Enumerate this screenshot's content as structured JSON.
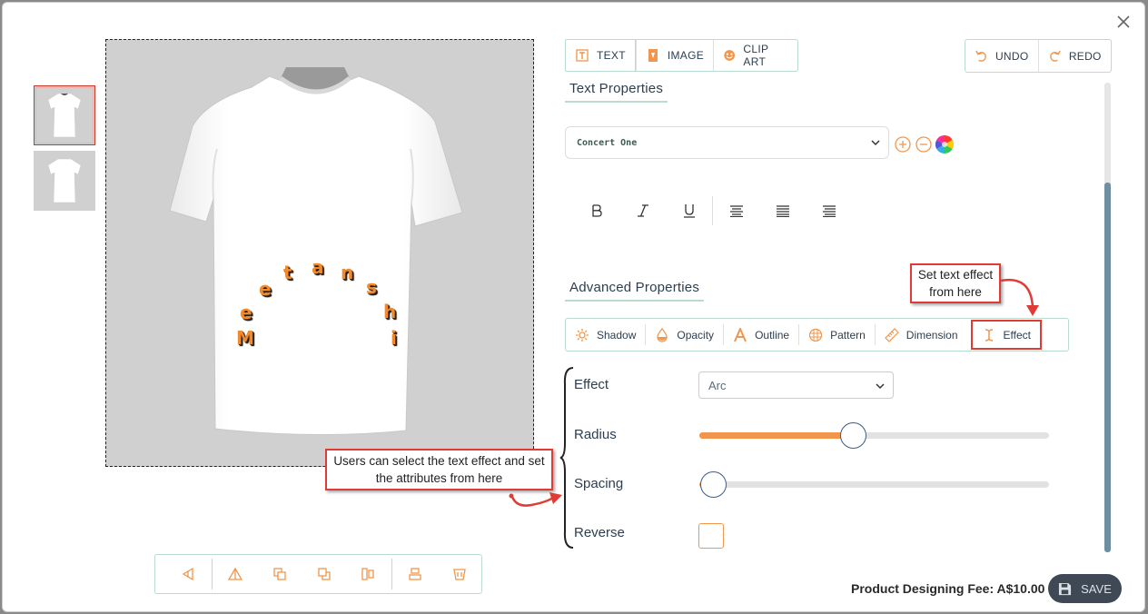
{
  "tabs": [
    {
      "label": "TEXT",
      "icon": "text-frame-icon",
      "active": true
    },
    {
      "label": "IMAGE",
      "icon": "image-icon",
      "active": false
    },
    {
      "label": "CLIP ART",
      "icon": "clip-art-icon",
      "active": false
    }
  ],
  "undo_label": "UNDO",
  "redo_label": "REDO",
  "text_properties_title": "Text Properties",
  "font": {
    "selected": "Concert One"
  },
  "advanced_properties_title": "Advanced Properties",
  "advanced_tabs": [
    {
      "label": "Shadow",
      "icon": "sun-icon"
    },
    {
      "label": "Opacity",
      "icon": "drop-icon"
    },
    {
      "label": "Outline",
      "icon": "letter-a-icon"
    },
    {
      "label": "Pattern",
      "icon": "pattern-icon"
    },
    {
      "label": "Dimension",
      "icon": "ruler-icon"
    },
    {
      "label": "Effect",
      "icon": "text-cursor-icon",
      "active": true
    }
  ],
  "properties": {
    "effect_label": "Effect",
    "effect_value": "Arc",
    "radius_label": "Radius",
    "radius_value": 0.44,
    "spacing_label": "Spacing",
    "spacing_value": 0.04,
    "reverse_label": "Reverse",
    "reverse_checked": false
  },
  "design_text": "Meetanshi",
  "annotations": {
    "top": "Set text effect from here",
    "left": "Users can select the text effect and set the attributes from here"
  },
  "fee": "Product Designing Fee: A$10.00",
  "save_label": "SAVE",
  "colors": {
    "accent": "#f1964c",
    "annotation": "#e03b35",
    "border": "#b9dcd1",
    "save_bg": "#3e4955"
  }
}
